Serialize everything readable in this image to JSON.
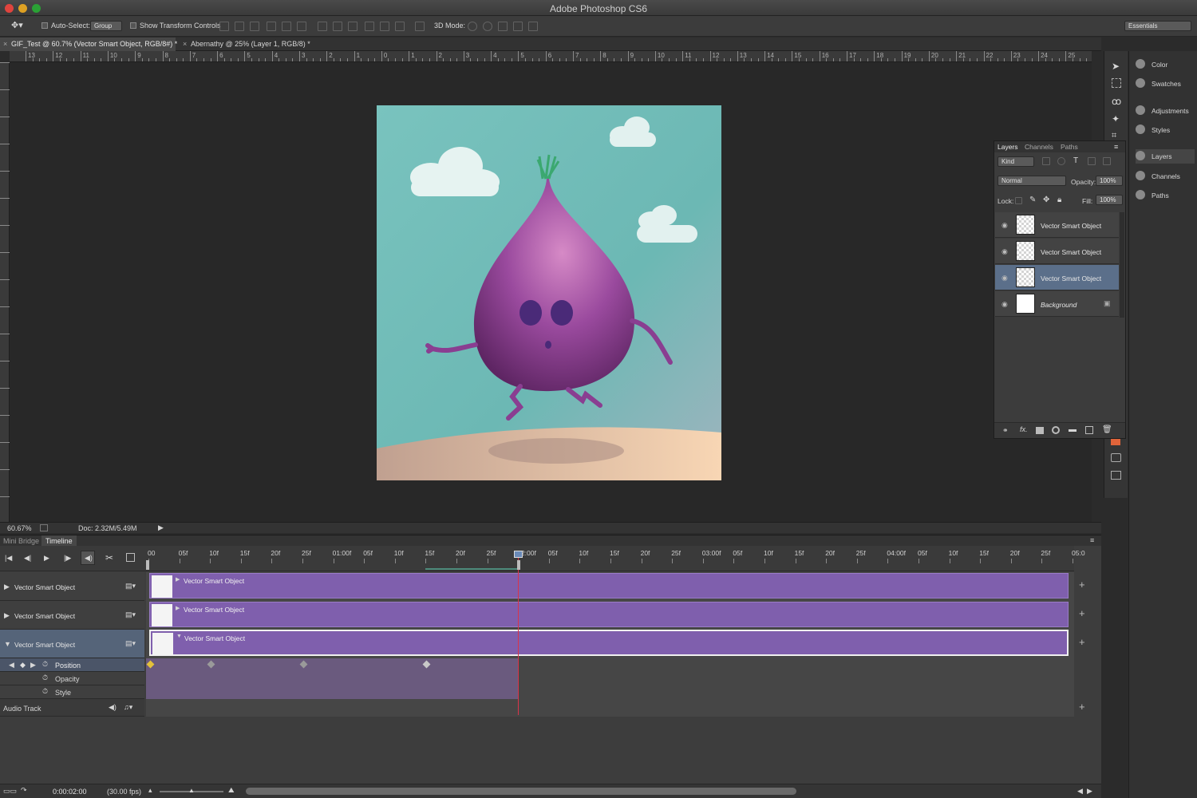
{
  "window": {
    "title": "Adobe Photoshop CS6"
  },
  "options_bar": {
    "auto_select_label": "Auto-Select:",
    "auto_select_value": "Group",
    "show_transform_label": "Show Transform Controls",
    "mode_3d_label": "3D Mode:",
    "workspace": "Essentials"
  },
  "doc_tabs": [
    {
      "label": "GIF_Test @ 60.7% (Vector Smart Object, RGB/8#) *"
    },
    {
      "label": "Abernathy @ 25% (Layer 1, RGB/8) *"
    }
  ],
  "ruler_top": [
    "13",
    "12",
    "11",
    "10",
    "9",
    "8",
    "7",
    "6",
    "5",
    "4",
    "3",
    "2",
    "1",
    "0",
    "1",
    "2",
    "3",
    "4",
    "5",
    "6",
    "7",
    "8",
    "9",
    "10",
    "11",
    "12",
    "13",
    "14",
    "15",
    "16",
    "17",
    "18",
    "19",
    "20",
    "21",
    "22",
    "23",
    "24",
    "25"
  ],
  "status": {
    "zoom": "60.67%",
    "doc": "Doc: 2.32M/5.49M"
  },
  "dock": [
    {
      "label": "Color",
      "icon": "color-icon"
    },
    {
      "label": "Swatches",
      "icon": "swatches-icon"
    },
    {
      "label": "Adjustments",
      "icon": "adjustments-icon"
    },
    {
      "label": "Styles",
      "icon": "styles-icon"
    },
    {
      "label": "Layers",
      "icon": "layers-icon"
    },
    {
      "label": "Channels",
      "icon": "channels-icon"
    },
    {
      "label": "Paths",
      "icon": "paths-icon"
    }
  ],
  "layers_panel": {
    "tabs": [
      "Layers",
      "Channels",
      "Paths"
    ],
    "filter_kind": "Kind",
    "blend_mode": "Normal",
    "opacity_label": "Opacity:",
    "opacity_value": "100%",
    "lock_label": "Lock:",
    "fill_label": "Fill:",
    "fill_value": "100%",
    "layers": [
      {
        "name": "Vector Smart Object"
      },
      {
        "name": "Vector Smart Object"
      },
      {
        "name": "Vector Smart Object"
      },
      {
        "name": "Background"
      }
    ]
  },
  "panel_tabs": {
    "mini_bridge": "Mini Bridge",
    "timeline": "Timeline"
  },
  "timeline": {
    "ruler": [
      "00",
      "05f",
      "10f",
      "15f",
      "20f",
      "25f",
      "01:00f",
      "05f",
      "10f",
      "15f",
      "20f",
      "25f",
      "02:00f",
      "05f",
      "10f",
      "15f",
      "20f",
      "25f",
      "03:00f",
      "05f",
      "10f",
      "15f",
      "20f",
      "25f",
      "04:00f",
      "05f",
      "10f",
      "15f",
      "20f",
      "25f",
      "05:0"
    ],
    "tracks": [
      {
        "label": "Vector Smart Object",
        "clip": "Vector Smart Object"
      },
      {
        "label": "Vector Smart Object",
        "clip": "Vector Smart Object"
      },
      {
        "label": "Vector Smart Object",
        "clip": "Vector Smart Object"
      }
    ],
    "props": [
      "Position",
      "Opacity",
      "Style"
    ],
    "audio_track": "Audio Track",
    "current_time": "0:00:02:00",
    "fps": "(30.00 fps)"
  }
}
